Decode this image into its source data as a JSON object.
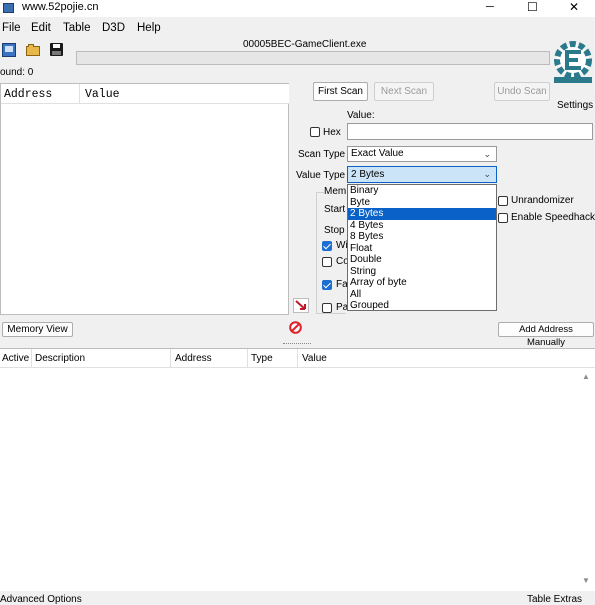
{
  "window": {
    "title": "www.52pojie.cn",
    "minimize": "─",
    "maximize": "☐",
    "close": "✕"
  },
  "menu": [
    "File",
    "Edit",
    "Table",
    "D3D",
    "Help"
  ],
  "process_title": "00005BEC-GameClient.exe",
  "found_label": "ound: 0",
  "results_header": {
    "address": "Address",
    "value": "Value"
  },
  "scan": {
    "first_scan": "First Scan",
    "next_scan": "Next Scan",
    "undo_scan": "Undo Scan",
    "settings": "Settings",
    "value_label": "Value:",
    "hex_label": "Hex",
    "scan_type_label": "Scan Type",
    "scan_type_value": "Exact Value",
    "value_type_label": "Value Type",
    "value_type_value": "2 Bytes",
    "memory_label": "Mem",
    "start_label": "Start",
    "stop_label": "Stop",
    "w_label": "Wi",
    "co_label": "Co",
    "fa_label": "Fa",
    "pause_label": "Pa",
    "unrandomizer": "Unrandomizer",
    "enable_speedhack": "Enable Speedhack"
  },
  "dropdown_options": [
    "Binary",
    "Byte",
    "2 Bytes",
    "4 Bytes",
    "8 Bytes",
    "Float",
    "Double",
    "String",
    "Array of byte",
    "All",
    "Grouped"
  ],
  "dropdown_selected": "2 Bytes",
  "memory_view": "Memory View",
  "add_address": "Add Address Manually",
  "table_header": {
    "active": "Active",
    "description": "Description",
    "address": "Address",
    "type": "Type",
    "value": "Value"
  },
  "footer": {
    "advanced": "Advanced Options",
    "extras": "Table Extras"
  },
  "colors": {
    "accent": "#0a62c9",
    "logo": "#2a7a8c"
  }
}
